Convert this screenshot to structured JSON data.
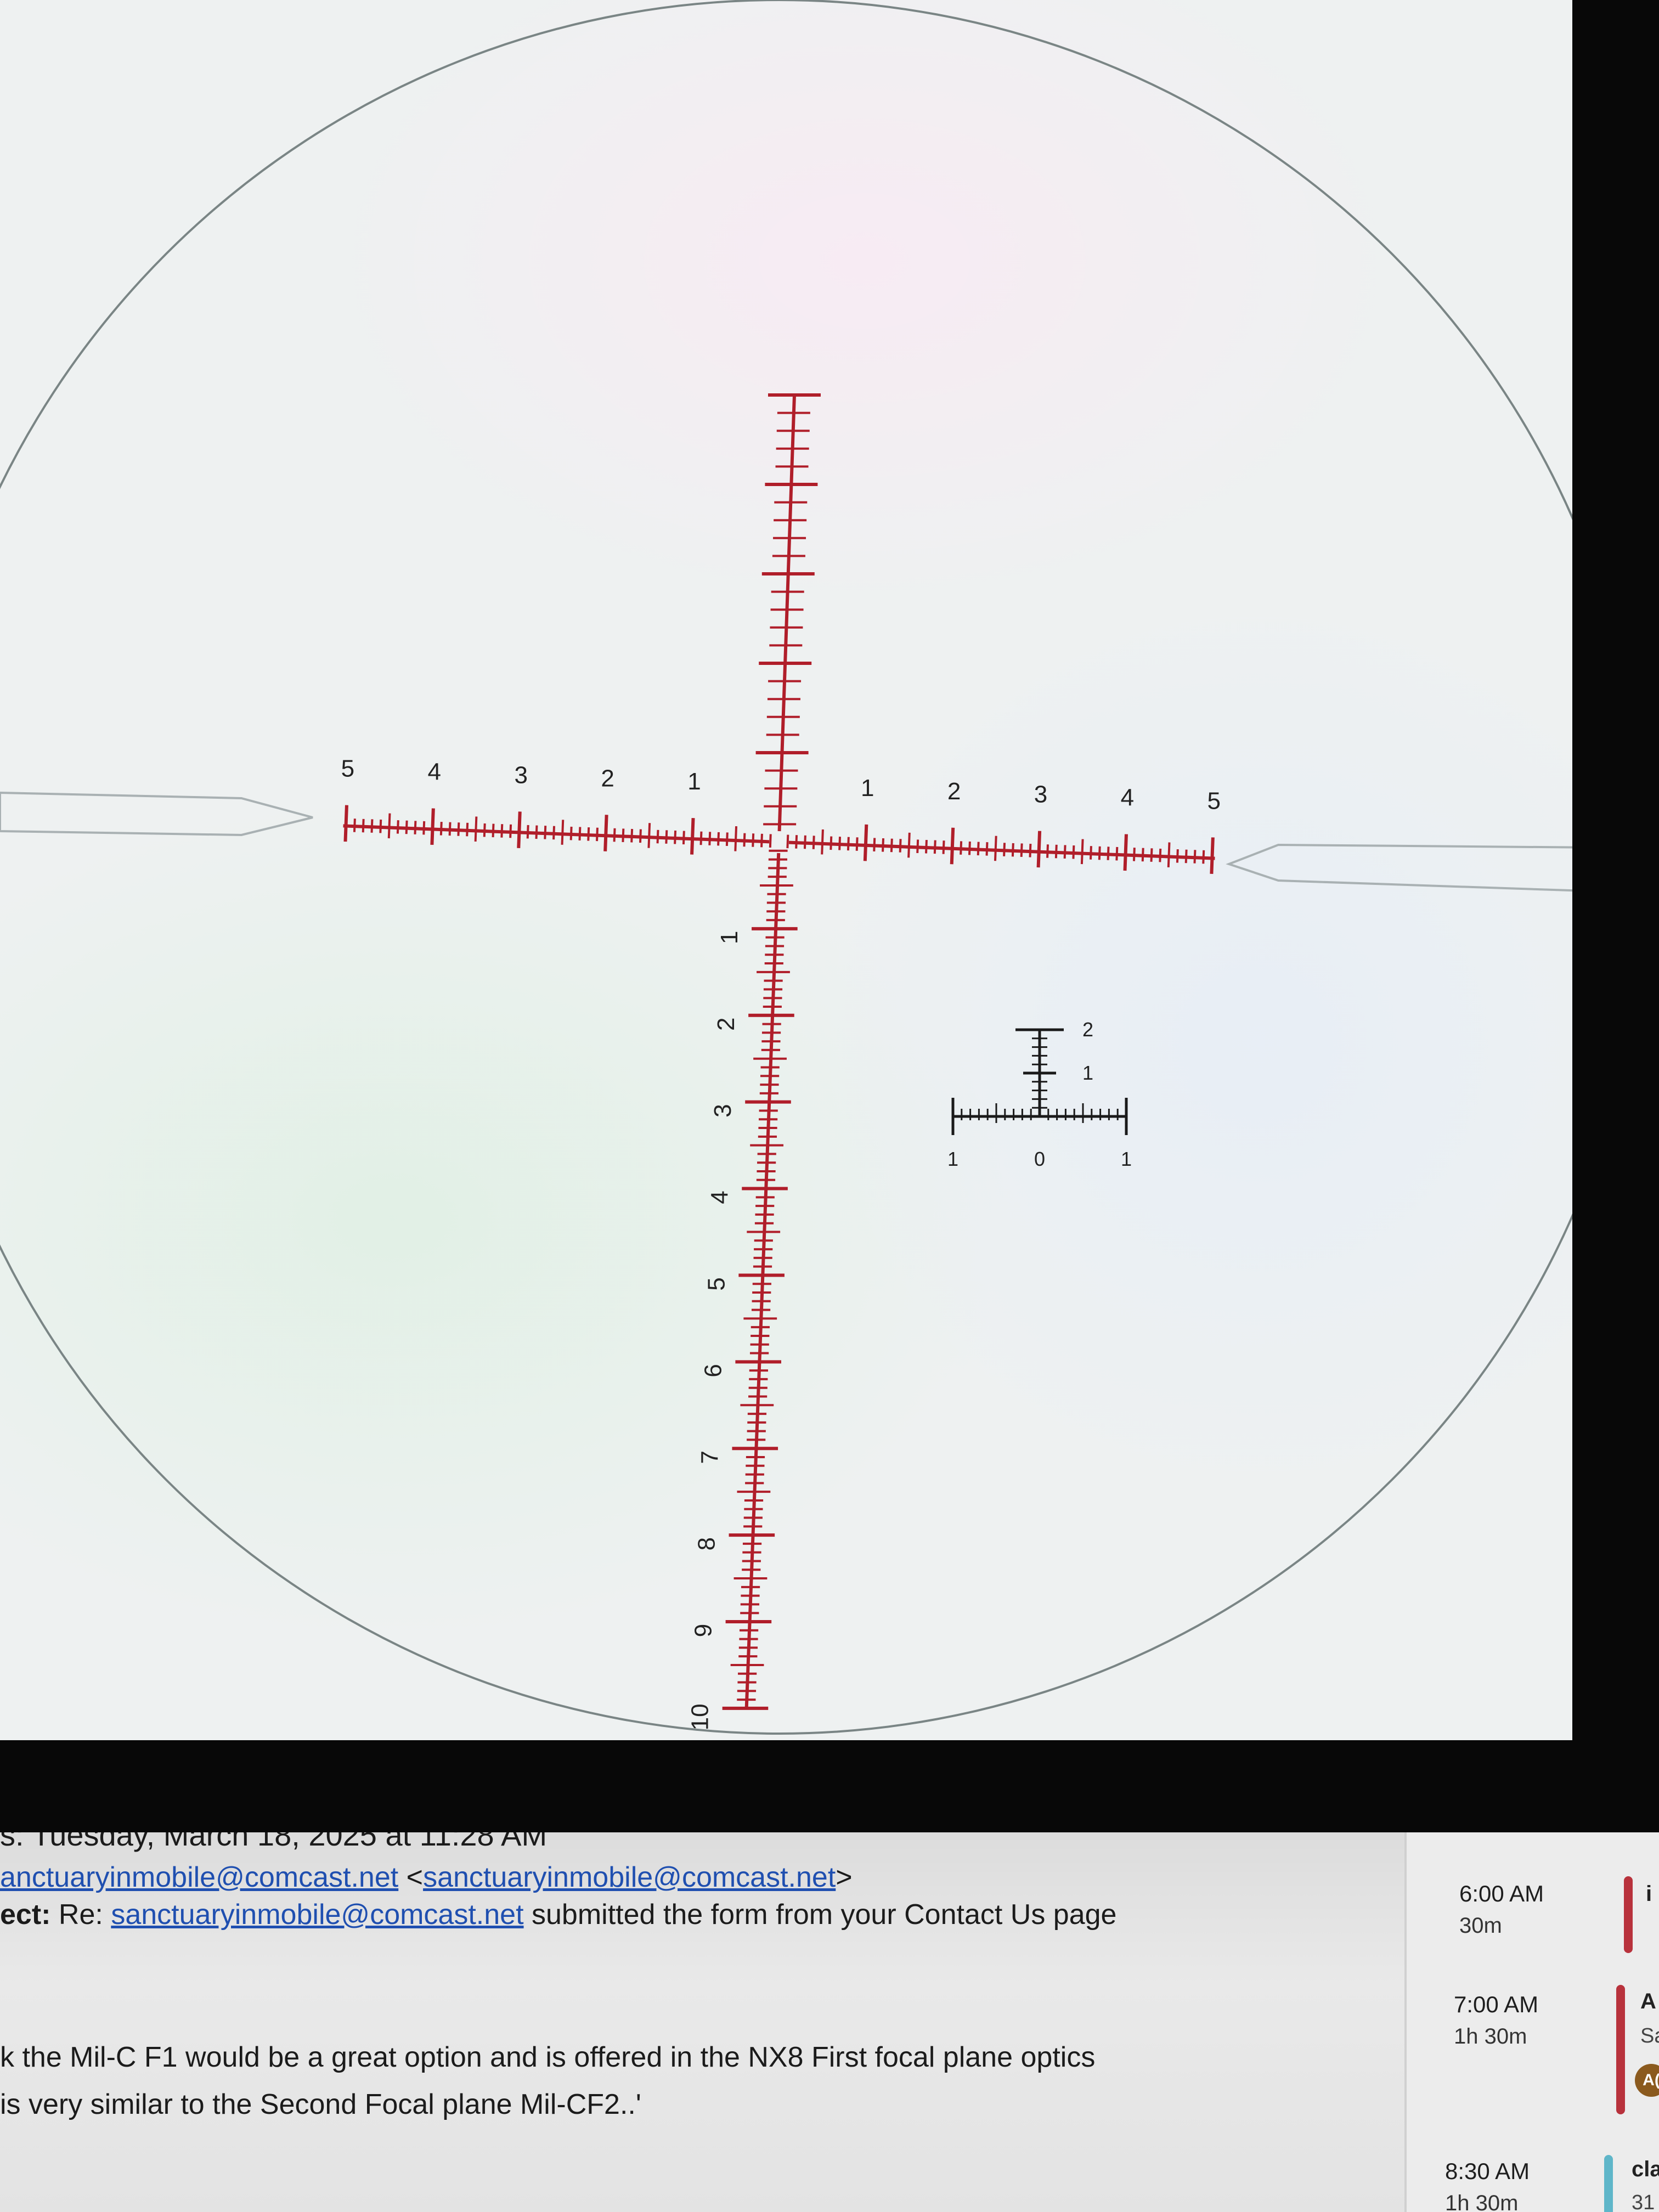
{
  "colors": {
    "reticle_main": "#b01e2a",
    "reticle_inset": "#1a1a1a",
    "scope_ring": "#7a8585",
    "link": "#1f4fb0",
    "event_red": "#b8323c",
    "event_teal": "#5fb6c9",
    "accent_brown": "#8b5a1e"
  },
  "reticle": {
    "left_labels": [
      "5",
      "4",
      "3",
      "2",
      "1"
    ],
    "right_labels": [
      "1",
      "2",
      "3",
      "4",
      "5"
    ],
    "lower_labels": [
      "1",
      "2",
      "3",
      "4",
      "5",
      "6",
      "7",
      "8",
      "9",
      "10"
    ],
    "inset_vertical_labels": [
      "2",
      "1"
    ],
    "inset_horizontal_labels": [
      "1",
      "0",
      "1"
    ]
  },
  "email": {
    "sent_line": "s: Tuesday, March 18, 2025 at 11:28 AM",
    "to_address": "anctuaryinmobile@comcast.net",
    "to_bracket_open": " <",
    "to_bracket_address": "sanctuaryinmobile@comcast.net",
    "to_bracket_close": ">",
    "subject_label": "ect:",
    "subject_prefix": " Re: ",
    "subject_link": "sanctuaryinmobile@comcast.net",
    "subject_suffix": " submitted the form from your Contact Us page",
    "body_line_1": "k the Mil-C F1 would be a great option and is offered in the NX8 First focal plane optics",
    "body_line_2": "is very similar to the Second Focal plane Mil-CF2..'"
  },
  "calendar": {
    "events": [
      {
        "time": "6:00 AM",
        "duration": "30m",
        "title": "i",
        "subtitle": ""
      },
      {
        "time": "7:00 AM",
        "duration": "1h 30m",
        "title": "A",
        "subtitle": "Sa",
        "badge": "A("
      },
      {
        "time": "8:30 AM",
        "duration": "1h 30m",
        "title": "cla",
        "subtitle": "31"
      }
    ]
  }
}
